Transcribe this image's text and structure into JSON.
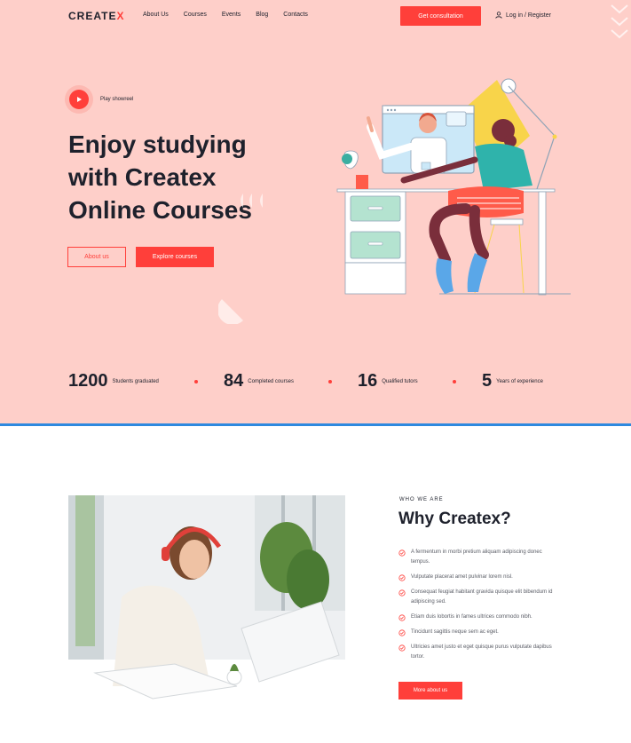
{
  "brand": {
    "logo_main": "CREATE",
    "logo_accent": "X",
    "accent_color": "#ff3f3a",
    "hero_bg": "#fecfc9"
  },
  "nav": {
    "items": [
      "About Us",
      "Courses",
      "Events",
      "Blog",
      "Contacts"
    ]
  },
  "header": {
    "consult_label": "Get consultation",
    "login_label": "Log in / Register"
  },
  "hero": {
    "play_label": "Play showreel",
    "title": "Enjoy studying with Createx Online Courses",
    "about_label": "About us",
    "explore_label": "Explore courses"
  },
  "stats": [
    {
      "value": "1200",
      "label": "Students graduated"
    },
    {
      "value": "84",
      "label": "Completed courses"
    },
    {
      "value": "16",
      "label": "Qualified tutors"
    },
    {
      "value": "5",
      "label": "Years of experience"
    }
  ],
  "about": {
    "eyebrow": "WHO WE ARE",
    "title": "Why Createx?",
    "items": [
      "A fermentum in morbi pretium aliquam adipiscing donec tempus.",
      "Vulputate placerat amet pulvinar lorem nisl.",
      "Consequat feugiat habitant gravida quisque elit bibendum id adipiscing sed.",
      "Etiam duis lobortis in fames ultrices commodo nibh.",
      "Tincidunt sagittis neque sem ac eget.",
      "Ultricies amet justo et eget quisque purus vulputate dapibus tortor."
    ],
    "more_label": "More about us"
  },
  "icons": {
    "play": "play-icon",
    "user": "user-icon",
    "check": "check-circle-icon",
    "chevrons": "chevrons-down-icon"
  }
}
